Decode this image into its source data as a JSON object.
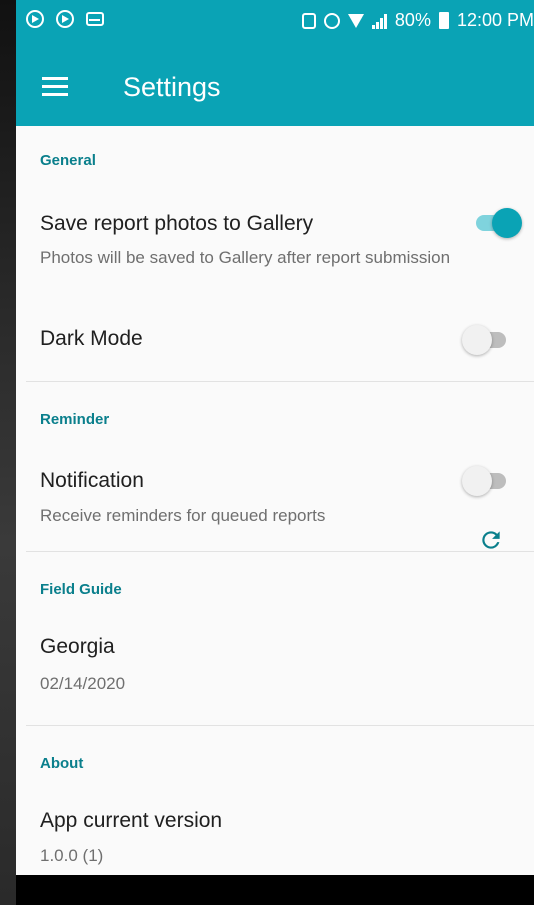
{
  "status_bar": {
    "battery": "80%",
    "time": "12:00 PM"
  },
  "appbar": {
    "title": "Settings",
    "menu_icon": "hamburger-menu-icon"
  },
  "sections": {
    "general": {
      "header": "General",
      "save_photos": {
        "title": "Save report photos to Gallery",
        "subtitle": "Photos will be saved to Gallery after report submission",
        "enabled": true
      },
      "dark_mode": {
        "title": "Dark Mode",
        "enabled": false
      }
    },
    "reminder": {
      "header": "Reminder",
      "notification": {
        "title": "Notification",
        "subtitle": "Receive reminders for queued reports",
        "enabled": false
      }
    },
    "field_guide": {
      "header": "Field Guide",
      "guide": {
        "title": "Georgia",
        "subtitle": "02/14/2020",
        "action_icon": "refresh-icon"
      }
    },
    "about": {
      "header": "About",
      "version": {
        "title": "App current version",
        "subtitle": "1.0.0 (1)"
      }
    }
  },
  "colors": {
    "primary": "#0aa3b5",
    "section_header": "#0a7f8c"
  }
}
